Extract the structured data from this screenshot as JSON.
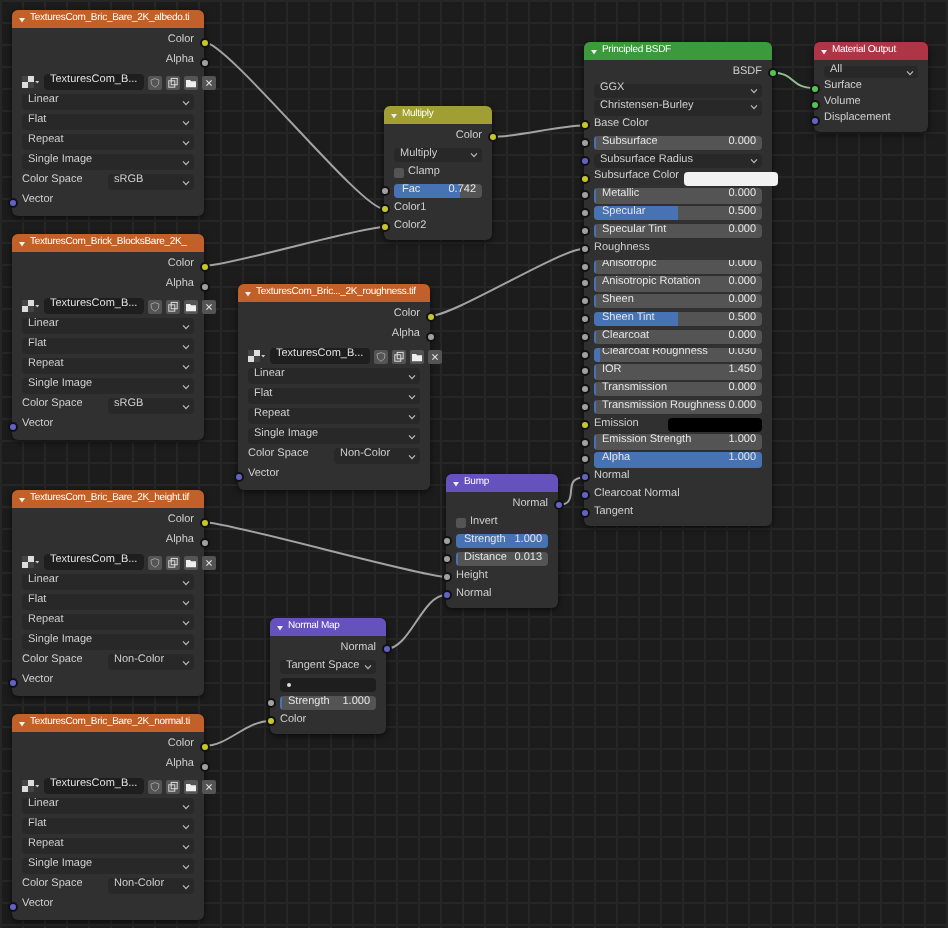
{
  "nodes": [
    {
      "kind": "texture",
      "title": "TexturesCom_Bric_Bare_2K_albedo.ti",
      "rows": [
        {
          "kind": "output",
          "label": "Color",
          "socket": {
            "color": "#c7c729"
          }
        },
        {
          "kind": "output",
          "label": "Alpha",
          "socket": {
            "color": "#a1a1a1"
          }
        },
        {
          "kind": "image",
          "value": "TexturesCom_B..."
        },
        {
          "kind": "dropdown",
          "value": "Linear"
        },
        {
          "kind": "dropdown",
          "value": "Flat"
        },
        {
          "kind": "dropdown",
          "value": "Repeat"
        },
        {
          "kind": "dropdown",
          "value": "Single Image"
        },
        {
          "kind": "prop",
          "label": "Color Space",
          "value": "sRGB"
        },
        {
          "kind": "input",
          "label": "Vector",
          "socket": {
            "color": "#6363c7"
          }
        }
      ]
    },
    {
      "kind": "texture",
      "title": "TexturesCom_Brick_BlocksBare_2K_",
      "rows": [
        {
          "kind": "output",
          "label": "Color",
          "socket": {
            "color": "#c7c729"
          }
        },
        {
          "kind": "output",
          "label": "Alpha",
          "socket": {
            "color": "#a1a1a1"
          }
        },
        {
          "kind": "image",
          "value": "TexturesCom_B..."
        },
        {
          "kind": "dropdown",
          "value": "Linear"
        },
        {
          "kind": "dropdown",
          "value": "Flat"
        },
        {
          "kind": "dropdown",
          "value": "Repeat"
        },
        {
          "kind": "dropdown",
          "value": "Single Image"
        },
        {
          "kind": "prop",
          "label": "Color Space",
          "value": "sRGB"
        },
        {
          "kind": "input",
          "label": "Vector",
          "socket": {
            "color": "#6363c7"
          }
        }
      ]
    },
    {
      "kind": "texture",
      "title": "TexturesCom_Bric..._2K_roughness.tif",
      "rows": [
        {
          "kind": "output",
          "label": "Color",
          "socket": {
            "color": "#c7c729"
          }
        },
        {
          "kind": "output",
          "label": "Alpha",
          "socket": {
            "color": "#a1a1a1"
          }
        },
        {
          "kind": "image",
          "value": "TexturesCom_B..."
        },
        {
          "kind": "dropdown",
          "value": "Linear"
        },
        {
          "kind": "dropdown",
          "value": "Flat"
        },
        {
          "kind": "dropdown",
          "value": "Repeat"
        },
        {
          "kind": "dropdown",
          "value": "Single Image"
        },
        {
          "kind": "prop",
          "label": "Color Space",
          "value": "Non-Color"
        },
        {
          "kind": "input",
          "label": "Vector",
          "socket": {
            "color": "#6363c7"
          }
        }
      ]
    },
    {
      "kind": "texture",
      "title": "TexturesCom_Bric_Bare_2K_height.tif",
      "rows": [
        {
          "kind": "output",
          "label": "Color",
          "socket": {
            "color": "#c7c729"
          }
        },
        {
          "kind": "output",
          "label": "Alpha",
          "socket": {
            "color": "#a1a1a1"
          }
        },
        {
          "kind": "image",
          "value": "TexturesCom_B..."
        },
        {
          "kind": "dropdown",
          "value": "Linear"
        },
        {
          "kind": "dropdown",
          "value": "Flat"
        },
        {
          "kind": "dropdown",
          "value": "Repeat"
        },
        {
          "kind": "dropdown",
          "value": "Single Image"
        },
        {
          "kind": "prop",
          "label": "Color Space",
          "value": "Non-Color"
        },
        {
          "kind": "input",
          "label": "Vector",
          "socket": {
            "color": "#6363c7"
          }
        }
      ]
    },
    {
      "kind": "texture",
      "title": "TexturesCom_Bric_Bare_2K_normal.ti",
      "rows": [
        {
          "kind": "output",
          "label": "Color",
          "socket": {
            "color": "#c7c729"
          }
        },
        {
          "kind": "output",
          "label": "Alpha",
          "socket": {
            "color": "#a1a1a1"
          }
        },
        {
          "kind": "image",
          "value": "TexturesCom_B..."
        },
        {
          "kind": "dropdown",
          "value": "Linear"
        },
        {
          "kind": "dropdown",
          "value": "Flat"
        },
        {
          "kind": "dropdown",
          "value": "Repeat"
        },
        {
          "kind": "dropdown",
          "value": "Single Image"
        },
        {
          "kind": "prop",
          "label": "Color Space",
          "value": "Non-Color"
        },
        {
          "kind": "input",
          "label": "Vector",
          "socket": {
            "color": "#6363c7"
          }
        }
      ]
    },
    {
      "kind": "color",
      "title": "Multiply",
      "rows": [
        {
          "kind": "output",
          "label": "Color",
          "socket": {
            "color": "#c7c729"
          }
        },
        {
          "kind": "dropdown",
          "value": "Multiply"
        },
        {
          "kind": "checkbox",
          "label": "Clamp",
          "checked": false
        },
        {
          "kind": "slider",
          "label": "Fac",
          "value": "0.742",
          "level": 0.742,
          "socket": {
            "color": "#a1a1a1"
          }
        },
        {
          "kind": "input",
          "label": "Color1",
          "socket": {
            "color": "#c7c729"
          }
        },
        {
          "kind": "input",
          "label": "Color2",
          "socket": {
            "color": "#c7c729"
          }
        }
      ]
    },
    {
      "kind": "vector",
      "title": "Bump",
      "rows": [
        {
          "kind": "output",
          "label": "Normal",
          "socket": {
            "color": "#6363c7"
          }
        },
        {
          "kind": "checkbox",
          "label": "Invert",
          "checked": false
        },
        {
          "kind": "slider",
          "label": "Strength",
          "value": "1.000",
          "level": 1,
          "socket": {
            "color": "#a1a1a1"
          }
        },
        {
          "kind": "slider",
          "label": "Distance",
          "value": "0.013",
          "level": 0.013,
          "socket": {
            "color": "#a1a1a1"
          }
        },
        {
          "kind": "input",
          "label": "Height",
          "socket": {
            "color": "#a1a1a1"
          }
        },
        {
          "kind": "input",
          "label": "Normal",
          "socket": {
            "color": "#6363c7"
          }
        }
      ]
    },
    {
      "kind": "vector",
      "title": "Normal Map",
      "rows": [
        {
          "kind": "output",
          "label": "Normal",
          "socket": {
            "color": "#6363c7"
          }
        },
        {
          "kind": "dropdown",
          "value": "Tangent Space"
        },
        {
          "kind": "uvfield"
        },
        {
          "kind": "slider",
          "label": "Strength",
          "value": "1.000",
          "level": 0,
          "socket": {
            "color": "#a1a1a1"
          }
        },
        {
          "kind": "input",
          "label": "Color",
          "socket": {
            "color": "#c7c729"
          }
        }
      ]
    },
    {
      "kind": "shader",
      "title": "Principled BSDF",
      "rows": [
        {
          "kind": "output",
          "label": "BSDF",
          "socket": {
            "color": "#52c452"
          }
        },
        {
          "kind": "dropdown",
          "value": "GGX"
        },
        {
          "kind": "dropdown",
          "value": "Christensen-Burley"
        },
        {
          "kind": "input",
          "label": "Base Color",
          "socket": {
            "color": "#c7c729"
          }
        },
        {
          "kind": "slider",
          "label": "Subsurface",
          "value": "0.000",
          "level": 0,
          "socket": {
            "color": "#a1a1a1"
          }
        },
        {
          "kind": "dropdown",
          "value": "Subsurface Radius",
          "socket": {
            "color": "#6363c7"
          }
        },
        {
          "kind": "swatch",
          "label": "Subsurface Color",
          "color": "#f2f2f2",
          "socket": {
            "color": "#c7c729"
          }
        },
        {
          "kind": "slider",
          "label": "Metallic",
          "value": "0.000",
          "level": 0,
          "socket": {
            "color": "#a1a1a1"
          }
        },
        {
          "kind": "slider",
          "label": "Specular",
          "value": "0.500",
          "level": 0.5,
          "socket": {
            "color": "#a1a1a1"
          }
        },
        {
          "kind": "slider",
          "label": "Specular Tint",
          "value": "0.000",
          "level": 0,
          "socket": {
            "color": "#a1a1a1"
          }
        },
        {
          "kind": "input",
          "label": "Roughness",
          "socket": {
            "color": "#a1a1a1"
          }
        },
        {
          "kind": "slider",
          "label": "Anisotropic",
          "value": "0.000",
          "level": 0,
          "socket": {
            "color": "#a1a1a1"
          }
        },
        {
          "kind": "slider",
          "label": "Anisotropic Rotation",
          "value": "0.000",
          "level": 0,
          "socket": {
            "color": "#a1a1a1"
          }
        },
        {
          "kind": "slider",
          "label": "Sheen",
          "value": "0.000",
          "level": 0,
          "socket": {
            "color": "#a1a1a1"
          }
        },
        {
          "kind": "slider",
          "label": "Sheen Tint",
          "value": "0.500",
          "level": 0.5,
          "socket": {
            "color": "#a1a1a1"
          }
        },
        {
          "kind": "slider",
          "label": "Clearcoat",
          "value": "0.000",
          "level": 0,
          "socket": {
            "color": "#a1a1a1"
          }
        },
        {
          "kind": "slider",
          "label": "Clearcoat Roughness",
          "value": "0.030",
          "level": 0.03,
          "socket": {
            "color": "#a1a1a1"
          }
        },
        {
          "kind": "slider",
          "label": "IOR",
          "value": "1.450",
          "level": 0,
          "socket": {
            "color": "#a1a1a1"
          }
        },
        {
          "kind": "slider",
          "label": "Transmission",
          "value": "0.000",
          "level": 0,
          "socket": {
            "color": "#a1a1a1"
          }
        },
        {
          "kind": "slider",
          "label": "Transmission Roughness",
          "value": "0.000",
          "level": 0,
          "socket": {
            "color": "#a1a1a1"
          }
        },
        {
          "kind": "swatch",
          "label": "Emission",
          "color": "#000000",
          "socket": {
            "color": "#c7c729"
          }
        },
        {
          "kind": "slider",
          "label": "Emission Strength",
          "value": "1.000",
          "level": 0,
          "socket": {
            "color": "#a1a1a1"
          }
        },
        {
          "kind": "slider",
          "label": "Alpha",
          "value": "1.000",
          "level": 1,
          "socket": {
            "color": "#a1a1a1"
          }
        },
        {
          "kind": "input",
          "label": "Normal",
          "socket": {
            "color": "#6363c7"
          }
        },
        {
          "kind": "input",
          "label": "Clearcoat Normal",
          "socket": {
            "color": "#6363c7"
          }
        },
        {
          "kind": "input",
          "label": "Tangent",
          "socket": {
            "color": "#6363c7"
          }
        }
      ]
    },
    {
      "kind": "output",
      "title": "Material Output",
      "rows": [
        {
          "kind": "dropdown",
          "value": "All"
        },
        {
          "kind": "input",
          "label": "Surface",
          "socket": {
            "color": "#52c452"
          }
        },
        {
          "kind": "input",
          "label": "Volume",
          "socket": {
            "color": "#52c452"
          }
        },
        {
          "kind": "input",
          "label": "Displacement",
          "socket": {
            "color": "#6363c7"
          }
        }
      ]
    }
  ]
}
